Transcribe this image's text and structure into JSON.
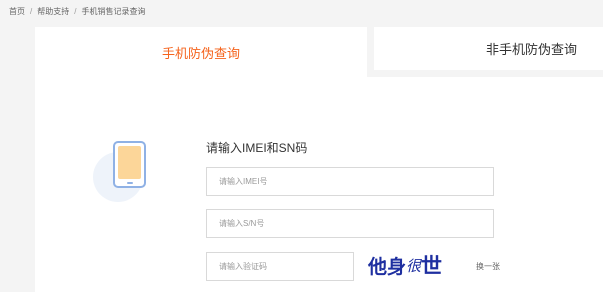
{
  "breadcrumb": {
    "items": [
      "首页",
      "帮助支持",
      "手机销售记录查询"
    ],
    "separator": "/"
  },
  "tabs": {
    "active_label": "手机防伪查询",
    "inactive_label": "非手机防伪查询",
    "active_color": "#f5641e"
  },
  "form": {
    "title": "请输入IMEI和SN码",
    "imei_placeholder": "请输入IMEI号",
    "sn_placeholder": "请输入S/N号",
    "captcha_placeholder": "请输入验证码",
    "captcha_chars": [
      "他",
      "身",
      "很",
      "世"
    ],
    "refresh_label": "换一张"
  },
  "icons": {
    "phone": "mobile-phone-icon"
  },
  "colors": {
    "page_bg": "#f4f4f4",
    "panel_bg": "#ffffff",
    "phone_outline": "#8fb1e5",
    "phone_screen": "#fcd699",
    "captcha_text": "#1e2fa0"
  }
}
